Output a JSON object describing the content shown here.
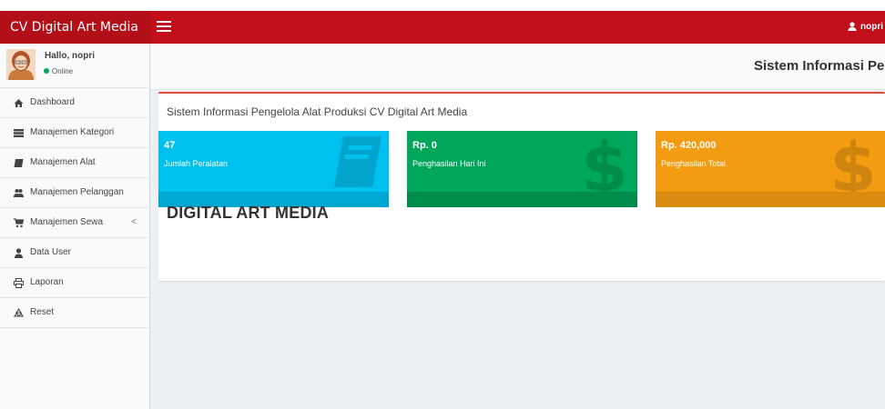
{
  "header": {
    "brand": "CV Digital Art Media",
    "user_name": "nopri",
    "accent": "#c1101b"
  },
  "user_panel": {
    "greeting": "Hallo, nopri",
    "status": "Online",
    "status_color": "#00a65a"
  },
  "sidebar": {
    "items": [
      {
        "label": "Dashboard",
        "icon": "home-icon"
      },
      {
        "label": "Manajemen Kategori",
        "icon": "list-icon"
      },
      {
        "label": "Manajemen Alat",
        "icon": "book-icon"
      },
      {
        "label": "Manajemen Pelanggan",
        "icon": "users-icon"
      },
      {
        "label": "Manajemen Sewa",
        "icon": "cart-icon",
        "caret": "<"
      },
      {
        "label": "Data User",
        "icon": "user-icon"
      },
      {
        "label": "Laporan",
        "icon": "print-icon"
      },
      {
        "label": "Reset",
        "icon": "recycle-icon"
      }
    ]
  },
  "content": {
    "page_heading": "Sistem Informasi Pen",
    "box_title": "Sistem Informasi Pengelola Alat Produksi CV Digital Art Media",
    "big_title": "DIGITAL ART MEDIA"
  },
  "stats": [
    {
      "value": "47",
      "label": "Jumlah Peralatan",
      "color": "#00c0ef",
      "footer_color": "#00a7d0",
      "icon": "book-icon"
    },
    {
      "value": "Rp. 0",
      "label": "Penghasilan Hari Ini",
      "color": "#00a65a",
      "footer_color": "#008d4c",
      "icon": "dollar-icon"
    },
    {
      "value": "Rp. 420,000",
      "label": "Penghasilan Total",
      "color": "#f39c12",
      "footer_color": "#da8c10",
      "icon": "dollar-icon"
    }
  ]
}
